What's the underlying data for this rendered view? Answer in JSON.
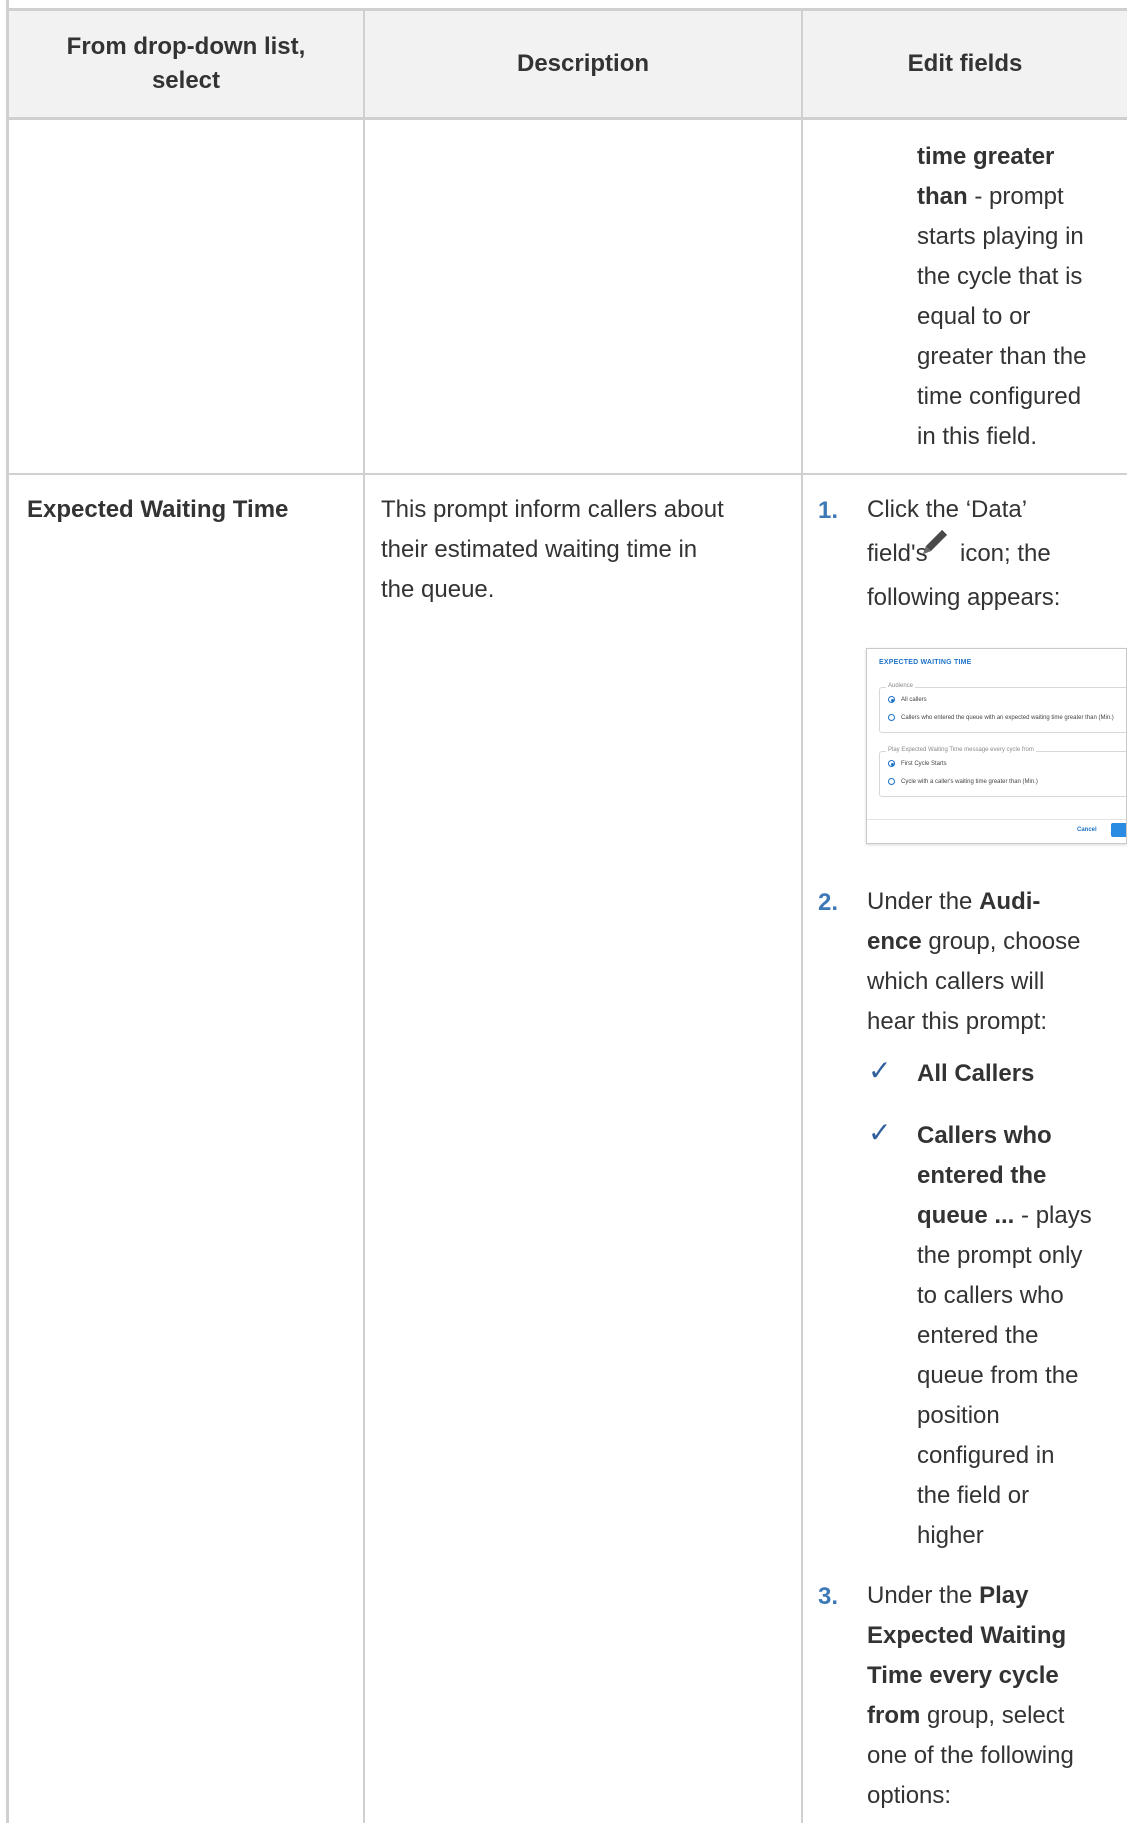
{
  "table": {
    "headers": [
      "From drop-down list, select",
      "Description",
      "Edit fields"
    ],
    "header_line1": [
      "From drop-down list,",
      "Description",
      "Edit fields"
    ],
    "header_line2": [
      "select",
      "",
      ""
    ],
    "continued_cell_lines": [
      {
        "text": "time greater",
        "bold": true
      },
      {
        "text": "than",
        "bold": true,
        "suffix": " - prompt"
      },
      {
        "text": "starts playing in"
      },
      {
        "text": "the cycle that is"
      },
      {
        "text": "equal to or"
      },
      {
        "text": "greater than the"
      },
      {
        "text": "time configured"
      },
      {
        "text": "in this field."
      }
    ],
    "row": {
      "select": "Expected Waiting Time",
      "description_lines": [
        "This prompt inform callers about",
        "their estimated waiting time in",
        "the queue."
      ]
    }
  },
  "steps": {
    "step1": {
      "number": "1.",
      "line1": "Click the ‘Data’",
      "line2a": "field's",
      "line2b": "icon; the",
      "line3": "following appears:",
      "icon": "pencil-icon"
    },
    "step2": {
      "number": "2.",
      "line1a": "Under the ",
      "line1b": "Audi-",
      "line2a": "ence",
      "line2b": " group, choose",
      "line3": "which callers will",
      "line4": "hear this prompt:"
    },
    "options": [
      {
        "lines": [
          "All Callers"
        ]
      },
      {
        "lines": [
          "Callers who",
          "entered the",
          "queue ..."
        ],
        "suffix": " - plays",
        "rest": [
          "the prompt only",
          "to callers who",
          "entered the",
          "queue from the",
          "position",
          "configured in",
          "the field or",
          "higher"
        ]
      }
    ],
    "step3": {
      "number": "3.",
      "line1a": "Under the ",
      "line1b": "Play",
      "line2": "Expected Waiting",
      "line3": "Time every cycle",
      "line4a": "from",
      "line4b": " group, select",
      "line5": "one of the following",
      "line6": "options:"
    },
    "check_symbol": "✓"
  },
  "dialog": {
    "title": "EXPECTED WAITING TIME",
    "audience_legend": "Audience",
    "audience_opt1": "All callers",
    "audience_opt2": "Callers who entered the queue with an expected waiting time greater than (Min.)",
    "play_legend": "Play Expected Waiting Time message every cycle from",
    "play_opt1": "First Cycle Starts",
    "play_opt2": "Cycle with a caller's waiting time greater than (Min.)",
    "cancel": "Cancel"
  },
  "colors": {
    "border": "#d0d0d0",
    "header_bg": "#f2f2f2",
    "step_number": "#3e79b7",
    "check": "#2f5f9c",
    "dialog_accent": "#1f73c9"
  }
}
